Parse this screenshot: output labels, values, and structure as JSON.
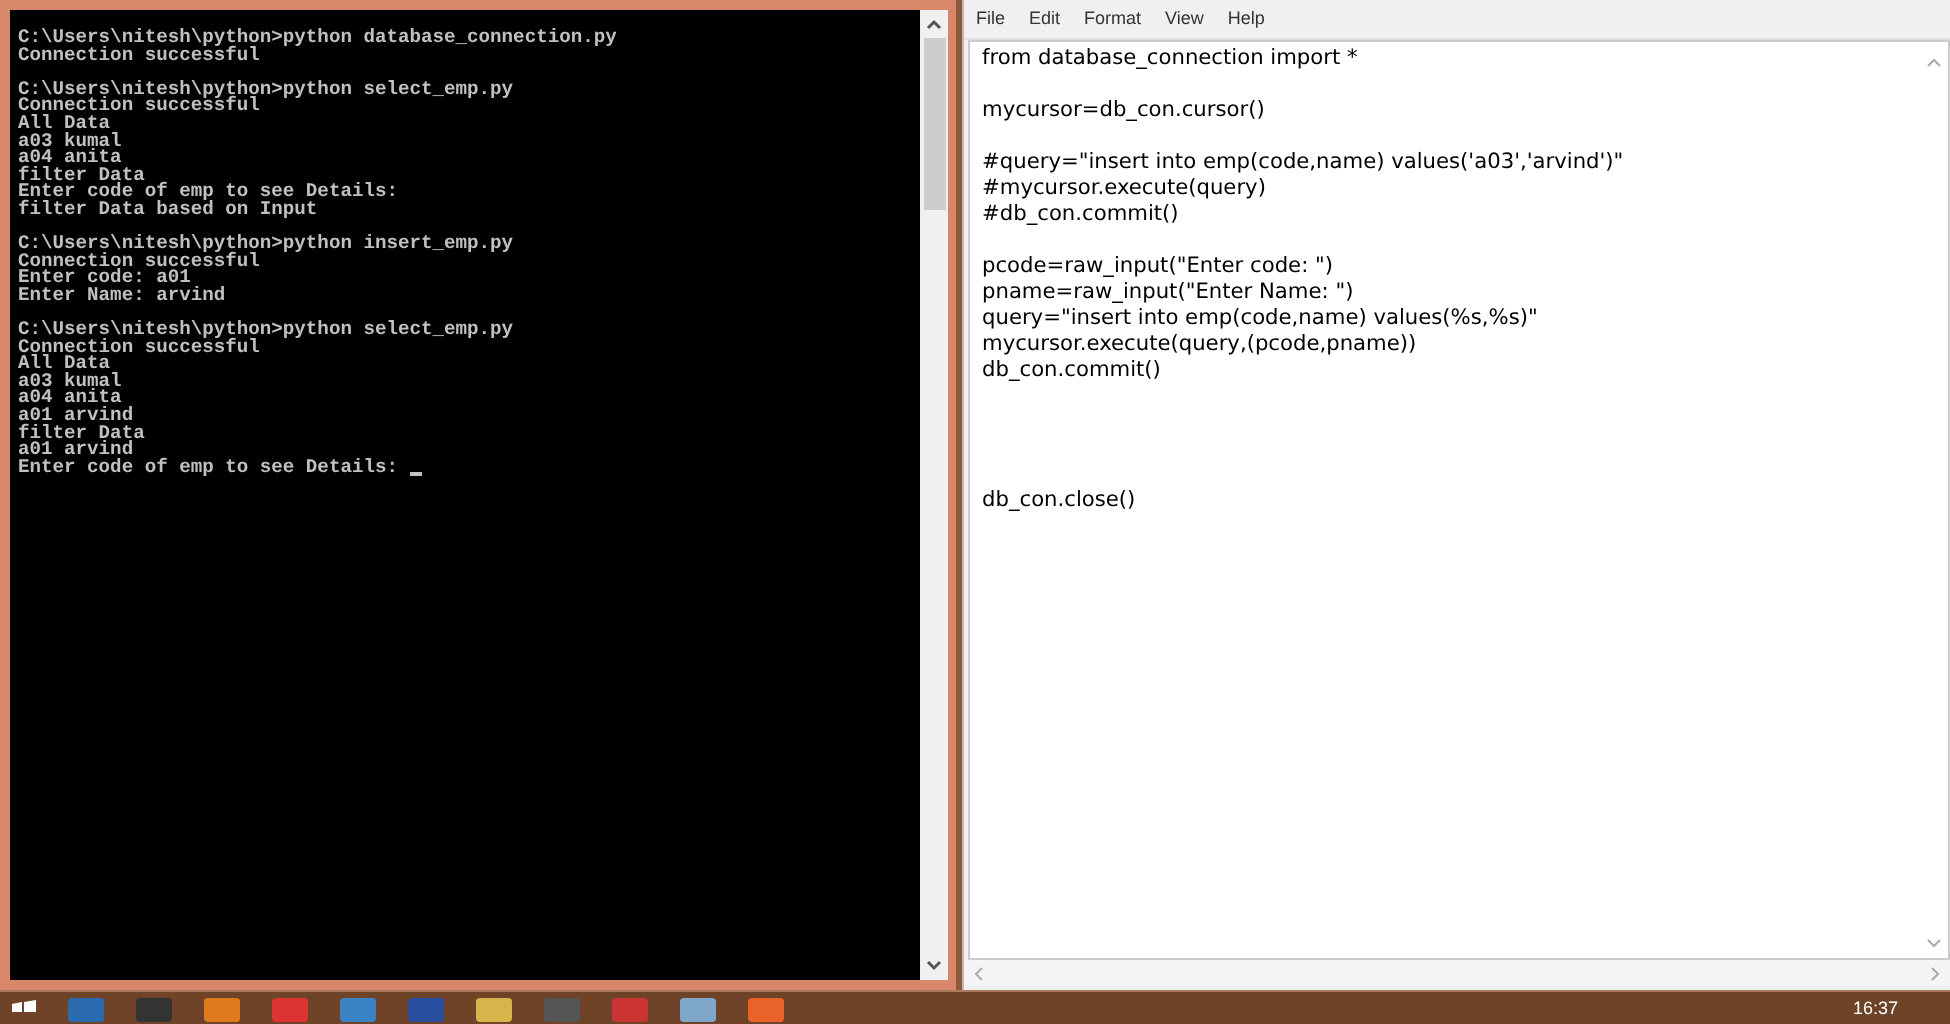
{
  "console": {
    "blocks": [
      [
        "C:\\Users\\nitesh\\python>python database_connection.py",
        "Connection successful"
      ],
      [
        "C:\\Users\\nitesh\\python>python select_emp.py",
        "Connection successful",
        "All Data",
        "a03 kumal",
        "a04 anita",
        "filter Data",
        "Enter code of emp to see Details:",
        "filter Data based on Input"
      ],
      [
        "C:\\Users\\nitesh\\python>python insert_emp.py",
        "Connection successful",
        "Enter code: a01",
        "Enter Name: arvind"
      ],
      [
        "C:\\Users\\nitesh\\python>python select_emp.py",
        "Connection successful",
        "All Data",
        "a03 kumal",
        "a04 anita",
        "a01 arvind",
        "filter Data",
        "a01 arvind",
        "Enter code of emp to see Details: "
      ]
    ]
  },
  "notepad": {
    "menu": [
      "File",
      "Edit",
      "Format",
      "View",
      "Help"
    ],
    "text": "from database_connection import *\n\nmycursor=db_con.cursor()\n\n#query=\"insert into emp(code,name) values('a03','arvind')\"\n#mycursor.execute(query)\n#db_con.commit()\n\npcode=raw_input(\"Enter code: \")\npname=raw_input(\"Enter Name: \")\nquery=\"insert into emp(code,name) values(%s,%s)\"\nmycursor.execute(query,(pcode,pname))\ndb_con.commit()\n\n\n\n\ndb_con.close()"
  },
  "taskbar": {
    "clock": "16:37"
  }
}
